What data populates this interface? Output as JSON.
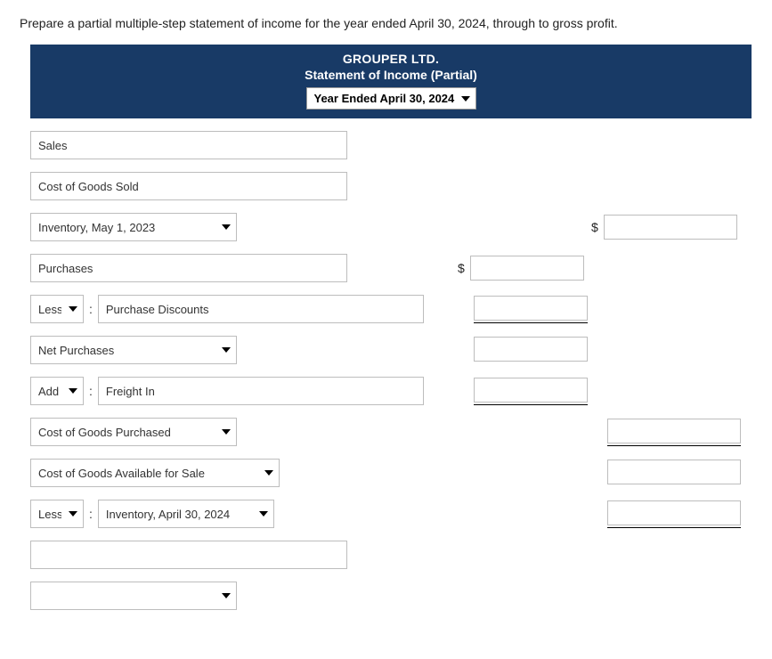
{
  "instruction": "Prepare a partial multiple-step statement of income for the year ended April 30, 2024, through to gross profit.",
  "header": {
    "company": "GROUPER LTD.",
    "title": "Statement of Income (Partial)",
    "period": "Year Ended April 30, 2024"
  },
  "rows": {
    "sales": "Sales",
    "cogs": "Cost of Goods Sold",
    "begin_inv": "Inventory, May 1, 2023",
    "purchases": "Purchases",
    "less": "Less",
    "purchase_discounts": "Purchase Discounts",
    "net_purchases": "Net Purchases",
    "add": "Add",
    "freight_in": "Freight In",
    "cogs_purchased": "Cost of Goods Purchased",
    "cogs_available": "Cost of Goods Available for Sale",
    "end_inv": "Inventory, April 30, 2024"
  },
  "symbols": {
    "dollar": "$",
    "colon": ":"
  }
}
